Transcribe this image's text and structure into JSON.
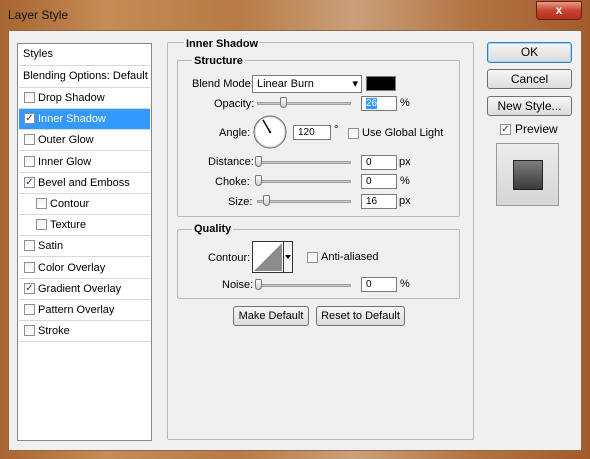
{
  "window": {
    "title": "Layer Style",
    "close_glyph": "x"
  },
  "styles_panel": {
    "header": "Styles",
    "blending_options": "Blending Options: Default",
    "items": [
      {
        "label": "Drop Shadow",
        "checked": false,
        "selected": false,
        "indent": false
      },
      {
        "label": "Inner Shadow",
        "checked": true,
        "selected": true,
        "indent": false
      },
      {
        "label": "Outer Glow",
        "checked": false,
        "selected": false,
        "indent": false
      },
      {
        "label": "Inner Glow",
        "checked": false,
        "selected": false,
        "indent": false
      },
      {
        "label": "Bevel and Emboss",
        "checked": true,
        "selected": false,
        "indent": false
      },
      {
        "label": "Contour",
        "checked": false,
        "selected": false,
        "indent": true
      },
      {
        "label": "Texture",
        "checked": false,
        "selected": false,
        "indent": true
      },
      {
        "label": "Satin",
        "checked": false,
        "selected": false,
        "indent": false
      },
      {
        "label": "Color Overlay",
        "checked": false,
        "selected": false,
        "indent": false
      },
      {
        "label": "Gradient Overlay",
        "checked": true,
        "selected": false,
        "indent": false
      },
      {
        "label": "Pattern Overlay",
        "checked": false,
        "selected": false,
        "indent": false
      },
      {
        "label": "Stroke",
        "checked": false,
        "selected": false,
        "indent": false
      }
    ]
  },
  "inner_shadow": {
    "title": "Inner Shadow",
    "structure": {
      "title": "Structure",
      "blend_mode_label": "Blend Mode:",
      "blend_mode_value": "Linear Burn",
      "blend_color": "#000000",
      "opacity_label": "Opacity:",
      "opacity_value": "26",
      "opacity_unit": "%",
      "opacity_level": 0.26,
      "angle_label": "Angle:",
      "angle_value": "120",
      "angle_unit": "°",
      "use_global_light_label": "Use Global Light",
      "use_global_light": false,
      "distance_label": "Distance:",
      "distance_value": "0",
      "distance_unit": "px",
      "distance_level": 0,
      "choke_label": "Choke:",
      "choke_value": "0",
      "choke_unit": "%",
      "choke_level": 0,
      "size_label": "Size:",
      "size_value": "16",
      "size_unit": "px",
      "size_level": 0.064
    },
    "quality": {
      "title": "Quality",
      "contour_label": "Contour:",
      "anti_aliased_label": "Anti-aliased",
      "anti_aliased": false,
      "noise_label": "Noise:",
      "noise_value": "0",
      "noise_unit": "%",
      "noise_level": 0
    },
    "make_default_label": "Make Default",
    "reset_default_label": "Reset to Default"
  },
  "actions": {
    "ok_label": "OK",
    "cancel_label": "Cancel",
    "new_style_label": "New Style...",
    "preview_label": "Preview",
    "preview_checked": true
  }
}
